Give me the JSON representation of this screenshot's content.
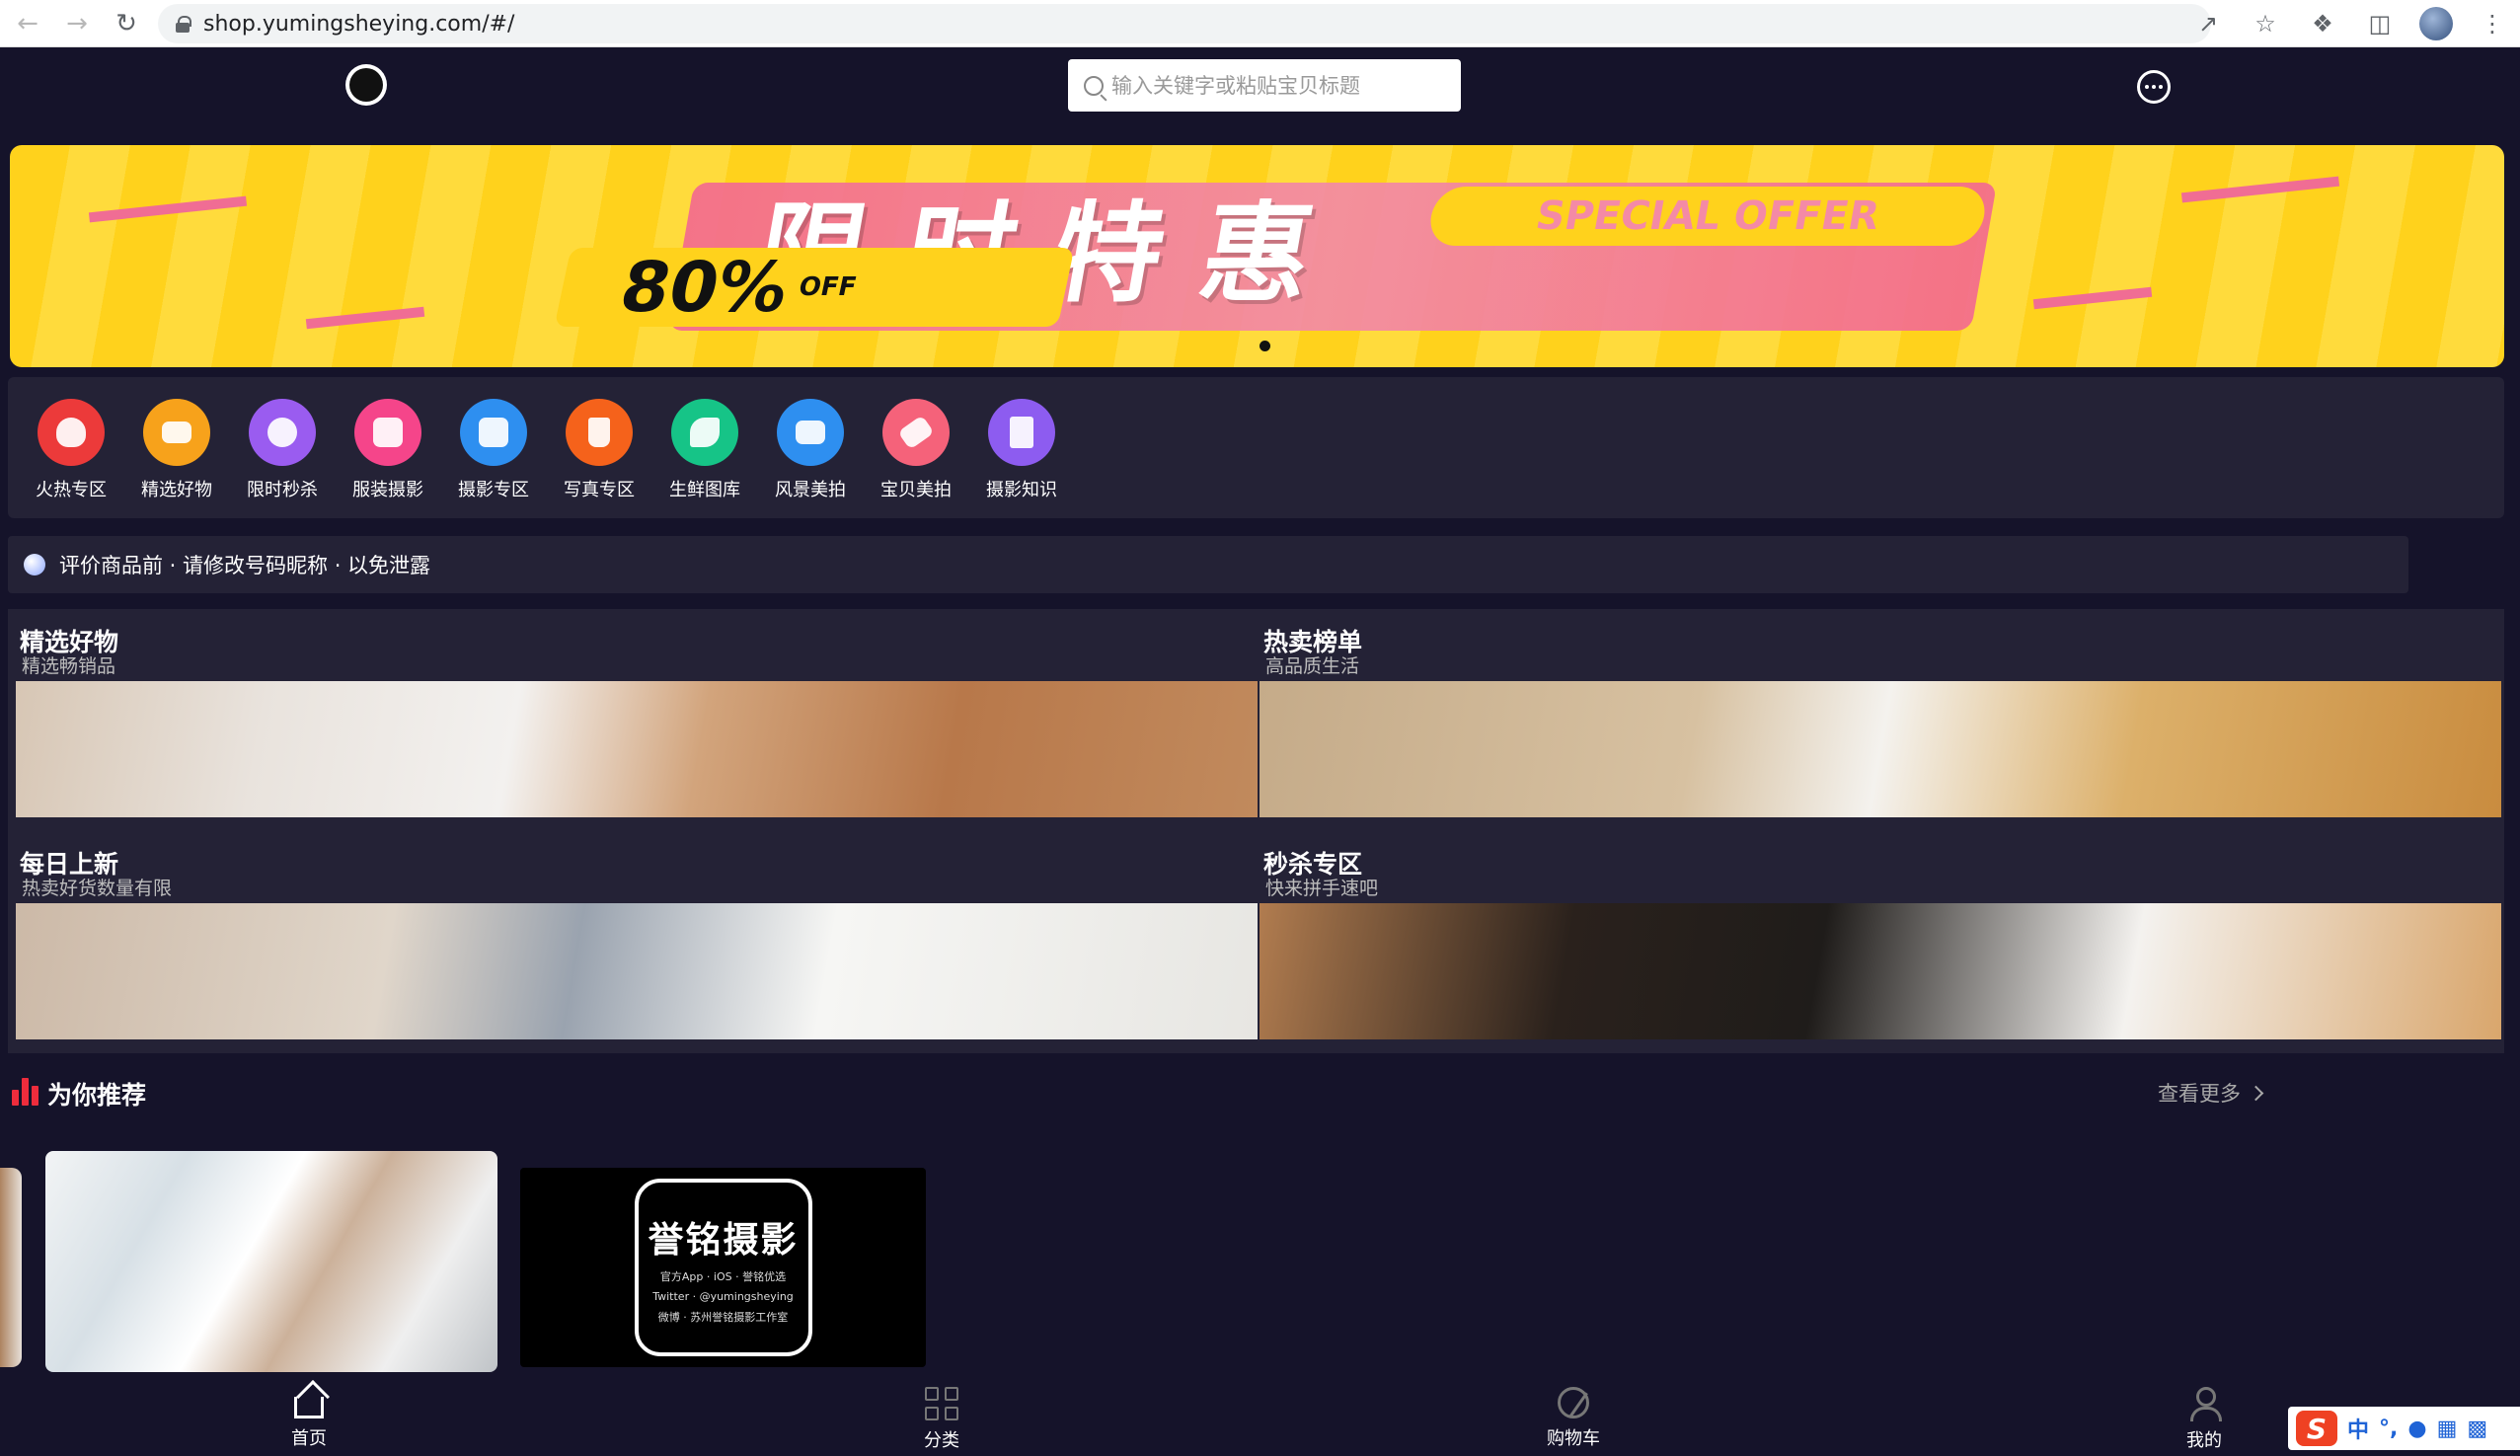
{
  "browser": {
    "url": "shop.yumingsheying.com/#/"
  },
  "header": {
    "search_placeholder": "输入关键字或粘贴宝贝标题"
  },
  "banner": {
    "title": "限时特惠",
    "special": "SPECIAL OFFER",
    "percent": "80%",
    "off": "OFF"
  },
  "categories": [
    {
      "label": "火热专区",
      "color": "#ec3a3a"
    },
    {
      "label": "精选好物",
      "color": "#f7a21b"
    },
    {
      "label": "限时秒杀",
      "color": "#9a5cf0"
    },
    {
      "label": "服装摄影",
      "color": "#f5458a"
    },
    {
      "label": "摄影专区",
      "color": "#2e8ff0"
    },
    {
      "label": "写真专区",
      "color": "#f5621b"
    },
    {
      "label": "生鲜图库",
      "color": "#16c487"
    },
    {
      "label": "风景美拍",
      "color": "#2e8ff0"
    },
    {
      "label": "宝贝美拍",
      "color": "#f5627a"
    },
    {
      "label": "摄影知识",
      "color": "#8d5cf0"
    }
  ],
  "notice": {
    "text": "评价商品前 · 请修改号码昵称 · 以免泄露"
  },
  "sections": [
    {
      "title": "精选好物",
      "subtitle": "精选畅销品"
    },
    {
      "title": "热卖榜单",
      "subtitle": "高品质生活"
    },
    {
      "title": "每日上新",
      "subtitle": "热卖好货数量有限"
    },
    {
      "title": "秒杀专区",
      "subtitle": "快来拼手速吧"
    }
  ],
  "recommend": {
    "title": "为你推荐",
    "view_more": "查看更多"
  },
  "brand_card": {
    "name": "誉铭摄影",
    "line1": "官方App · iOS · 誉铭优选",
    "line2": "Twitter · @yumingsheying",
    "line3": "微博 · 苏州誉铭摄影工作室"
  },
  "tabs": [
    {
      "label": "首页"
    },
    {
      "label": "分类"
    },
    {
      "label": "购物车"
    },
    {
      "label": "我的"
    }
  ],
  "ime": {
    "logo": "S",
    "mode": "中"
  }
}
